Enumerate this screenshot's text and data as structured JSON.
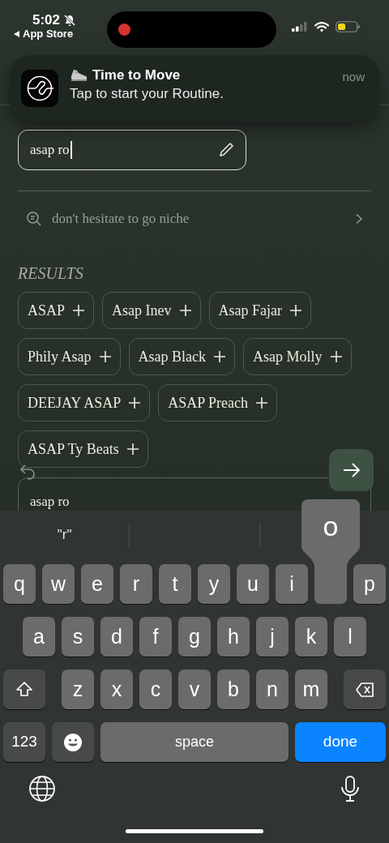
{
  "status_bar": {
    "time": "5:02",
    "back_label": "App Store"
  },
  "notification": {
    "title": "Time to Move",
    "body": "Tap to start your Routine.",
    "time": "now"
  },
  "search": {
    "value": "asap ro"
  },
  "hint": {
    "text": "don't hesitate to go niche"
  },
  "results": {
    "heading": "RESULTS",
    "items": [
      {
        "label": "ASAP"
      },
      {
        "label": "Asap Inev"
      },
      {
        "label": "Asap Fajar"
      },
      {
        "label": "Phily Asap"
      },
      {
        "label": "Asap Black"
      },
      {
        "label": "Asap Molly"
      },
      {
        "label": "DEEJAY ASAP"
      },
      {
        "label": "ASAP Preach"
      },
      {
        "label": "ASAP Ty Beats"
      }
    ]
  },
  "message": {
    "value": "asap ro"
  },
  "keyboard": {
    "suggestions": [
      "\"r\""
    ],
    "row_1": [
      {
        "kind": "letter",
        "label": "q",
        "pressed": false
      },
      {
        "kind": "letter",
        "label": "w",
        "pressed": false
      },
      {
        "kind": "letter",
        "label": "e",
        "pressed": false
      },
      {
        "kind": "letter",
        "label": "r",
        "pressed": false
      },
      {
        "kind": "letter",
        "label": "t",
        "pressed": false
      },
      {
        "kind": "letter",
        "label": "y",
        "pressed": false
      },
      {
        "kind": "letter",
        "label": "u",
        "pressed": false
      },
      {
        "kind": "letter",
        "label": "i",
        "pressed": false
      },
      {
        "kind": "letter",
        "label": "o",
        "pressed": true
      },
      {
        "kind": "letter",
        "label": "p",
        "pressed": false
      }
    ],
    "row_2": [
      {
        "kind": "letter",
        "label": "a",
        "pressed": false
      },
      {
        "kind": "letter",
        "label": "s",
        "pressed": false
      },
      {
        "kind": "letter",
        "label": "d",
        "pressed": false
      },
      {
        "kind": "letter",
        "label": "f",
        "pressed": false
      },
      {
        "kind": "letter",
        "label": "g",
        "pressed": false
      },
      {
        "kind": "letter",
        "label": "h",
        "pressed": false
      },
      {
        "kind": "letter",
        "label": "j",
        "pressed": false
      },
      {
        "kind": "letter",
        "label": "k",
        "pressed": false
      },
      {
        "kind": "letter",
        "label": "l",
        "pressed": false
      }
    ],
    "row_3": [
      {
        "kind": "shift",
        "pressed": false
      },
      {
        "kind": "letter",
        "label": "z",
        "pressed": false
      },
      {
        "kind": "letter",
        "label": "x",
        "pressed": false
      },
      {
        "kind": "letter",
        "label": "c",
        "pressed": false
      },
      {
        "kind": "letter",
        "label": "v",
        "pressed": false
      },
      {
        "kind": "letter",
        "label": "b",
        "pressed": false
      },
      {
        "kind": "letter",
        "label": "n",
        "pressed": false
      },
      {
        "kind": "letter",
        "label": "m",
        "pressed": false
      },
      {
        "kind": "delete",
        "pressed": false
      }
    ],
    "row_4": [
      {
        "kind": "numbers",
        "label": "123",
        "pressed": false
      },
      {
        "kind": "emoji",
        "pressed": false
      },
      {
        "kind": "space",
        "label": "space",
        "pressed": false
      },
      {
        "kind": "done",
        "label": "done",
        "pressed": false
      }
    ]
  }
}
